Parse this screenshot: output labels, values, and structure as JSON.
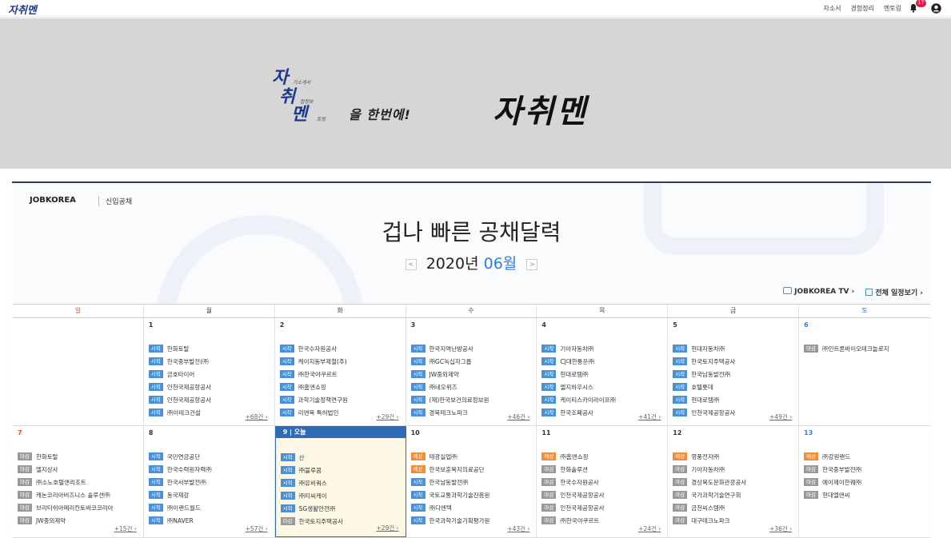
{
  "topbar": {
    "brand": "자취멘",
    "nav": [
      "자소서",
      "경험정리",
      "멘토링"
    ],
    "notification_count": "17"
  },
  "hero": {
    "ja": "자",
    "ja_sub": "기소개서",
    "chwi": "취",
    "chwi_sub": "업정보",
    "men": "멘",
    "men_sub": "토링",
    "once": "을 한번에!",
    "big": "자취멘"
  },
  "calendar": {
    "logo": "JOBKOREA",
    "sub": "신입공채",
    "title": "겁나 빠른 공채달력",
    "year": "2020년",
    "month": "06월",
    "prev": "<",
    "next": ">",
    "tv": "JOBKOREA TV",
    "all": "전체 일정보기",
    "dows": [
      "일",
      "월",
      "화",
      "수",
      "목",
      "금",
      "토"
    ],
    "today_label": "9 | 오늘",
    "weeks": [
      [
        {
          "day": "",
          "items": [],
          "more": ""
        },
        {
          "day": "1",
          "items": [
            [
              "시작",
              "한화토탈"
            ],
            [
              "시작",
              "한국중부발전(㈜"
            ],
            [
              "시작",
              "금호타이어"
            ],
            [
              "시작",
              "인천국제공항공사"
            ],
            [
              "시작",
              "인천국제공항공사"
            ],
            [
              "시작",
              "㈜이테크건설"
            ]
          ],
          "more": "+68건"
        },
        {
          "day": "2",
          "items": [
            [
              "시작",
              "한국수자원공사"
            ],
            [
              "시작",
              "케이지동부제철(주)"
            ],
            [
              "시작",
              "㈜한국야쿠르트"
            ],
            [
              "시작",
              "㈜홈앤쇼핑"
            ],
            [
              "시작",
              "과학기술정책연구원"
            ],
            [
              "시작",
              "리앤목 특허법인"
            ]
          ],
          "more": "+29건"
        },
        {
          "day": "3",
          "items": [
            [
              "시작",
              "한국지역난방공사"
            ],
            [
              "시작",
              "㈜GC녹십자그룹"
            ],
            [
              "시작",
              "JW중외제약"
            ],
            [
              "시작",
              "㈜네오위즈"
            ],
            [
              "시작",
              "(재)한국보건의료정보원"
            ],
            [
              "시작",
              "경북테크노파크"
            ]
          ],
          "more": "+46건"
        },
        {
          "day": "4",
          "items": [
            [
              "시작",
              "기아자동차㈜"
            ],
            [
              "시작",
              "CJ대한통운㈜"
            ],
            [
              "시작",
              "현대로템㈜"
            ],
            [
              "시작",
              "엘지하우시스"
            ],
            [
              "시작",
              "케이티스카이라이프㈜"
            ],
            [
              "시작",
              "한국조폐공사"
            ]
          ],
          "more": "+41건"
        },
        {
          "day": "5",
          "items": [
            [
              "시작",
              "현대자동차㈜"
            ],
            [
              "시작",
              "한국토지주택공사"
            ],
            [
              "시작",
              "한국남동발전㈜"
            ],
            [
              "시작",
              "호텔롯데"
            ],
            [
              "시작",
              "현대로템㈜"
            ],
            [
              "시작",
              "인천국제공항공사"
            ]
          ],
          "more": "+49건"
        },
        {
          "day": "6",
          "items": [
            [
              "마감",
              "㈜인트론바이오테크놀로지"
            ]
          ],
          "more": ""
        }
      ],
      [
        {
          "day": "7",
          "items": [
            [
              "마감",
              "한화토탈"
            ],
            [
              "마감",
              "엘지상사"
            ],
            [
              "마감",
              "㈜소노호텔앤리조트"
            ],
            [
              "마감",
              "캐논코리아비즈니스 솔루션㈜"
            ],
            [
              "마감",
              "브리티쉬아메리칸토바코코리아"
            ],
            [
              "마감",
              "JW중외제약"
            ]
          ],
          "more": "+15건"
        },
        {
          "day": "8",
          "items": [
            [
              "시작",
              "국민연금공단"
            ],
            [
              "시작",
              "한국수력원자력㈜"
            ],
            [
              "시작",
              "한국서부발전㈜"
            ],
            [
              "시작",
              "동국제강"
            ],
            [
              "시작",
              "㈜이랜드월드"
            ],
            [
              "시작",
              "㈜NAVER"
            ]
          ],
          "more": "+57건"
        },
        {
          "day": "9",
          "items": [
            [
              "시작",
              "산"
            ],
            [
              "시작",
              "㈜블루콤"
            ],
            [
              "시작",
              "㈜유비쿼스"
            ],
            [
              "시작",
              "㈜티씨케이"
            ],
            [
              "시작",
              "SG생활안전㈜"
            ],
            [
              "마감",
              "한국토지주택공사"
            ]
          ],
          "more": "+29건",
          "today": true
        },
        {
          "day": "10",
          "items": [
            [
              "예상",
              "태광실업㈜"
            ],
            [
              "예상",
              "한국보훈복지의료공단"
            ],
            [
              "시작",
              "한국남동발전㈜"
            ],
            [
              "시작",
              "국토교통과학기술진흥원"
            ],
            [
              "시작",
              "㈜디엔텍"
            ],
            [
              "시작",
              "한국과학기술기획평가원"
            ]
          ],
          "more": "+43건"
        },
        {
          "day": "11",
          "items": [
            [
              "예상",
              "㈜홈앤쇼핑"
            ],
            [
              "마감",
              "한화솔루션"
            ],
            [
              "마감",
              "한국수자원공사"
            ],
            [
              "마감",
              "인천국제공항공사"
            ],
            [
              "마감",
              "인천국제공항공사"
            ],
            [
              "마감",
              "㈜한국야쿠르트"
            ]
          ],
          "more": "+24건"
        },
        {
          "day": "12",
          "items": [
            [
              "예상",
              "영풍전자㈜"
            ],
            [
              "마감",
              "기아자동차㈜"
            ],
            [
              "마감",
              "경상북도문화관광공사"
            ],
            [
              "마감",
              "국가과학기술연구회"
            ],
            [
              "마감",
              "금천씨스템㈜"
            ],
            [
              "마감",
              "대구테크노파크"
            ]
          ],
          "more": "+36건"
        },
        {
          "day": "13",
          "items": [
            [
              "예상",
              "㈜강원랜드"
            ],
            [
              "마감",
              "한국중부발전㈜"
            ],
            [
              "마감",
              "에이제이한퀘㈜"
            ],
            [
              "마감",
              "현대엘앤씨"
            ]
          ],
          "more": ""
        }
      ]
    ]
  }
}
